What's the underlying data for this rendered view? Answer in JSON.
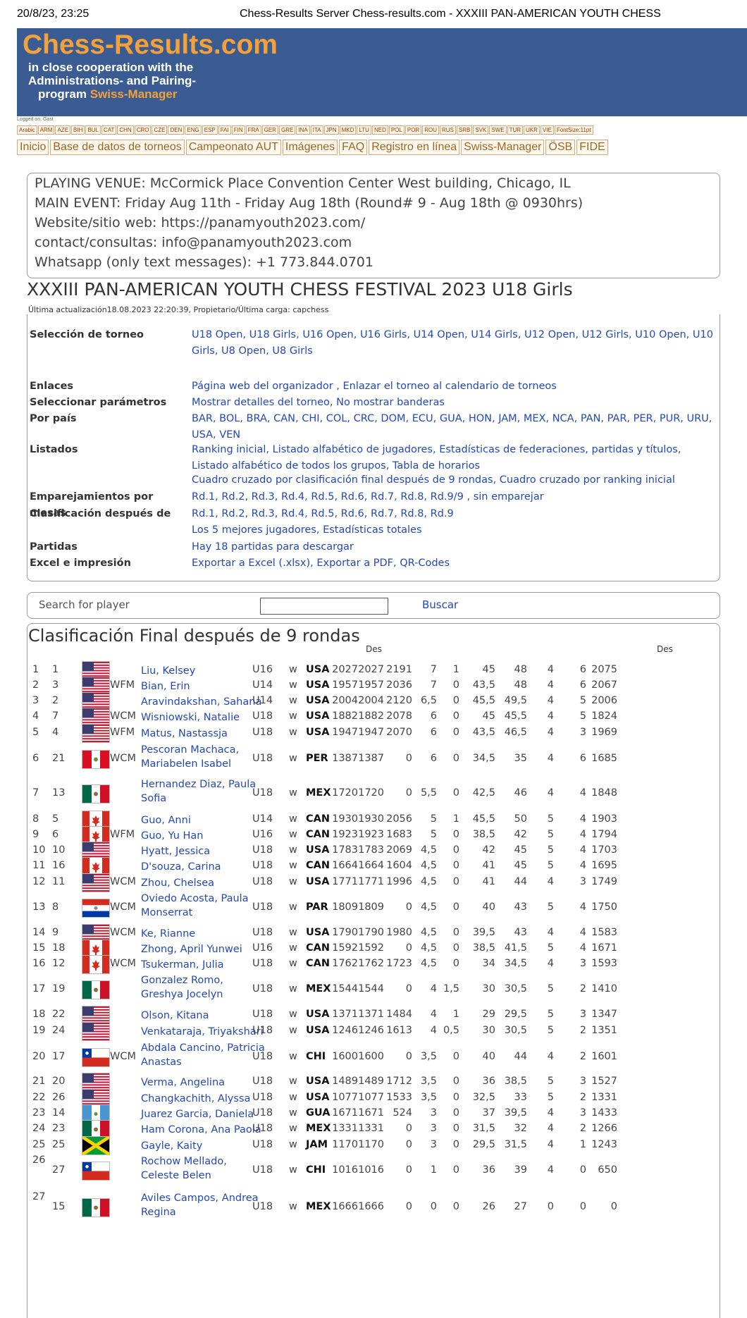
{
  "print_header": {
    "datetime": "20/8/23, 23:25",
    "title": "Chess-Results Server Chess-results.com - XXXIII PAN-AMERICAN YOUTH CHESS"
  },
  "banner": {
    "logo": "Chess-Results.com",
    "line1": "in close cooperation with the",
    "line2": "Administrations- and Pairing-",
    "line3_prefix": "program ",
    "line3_brand": "Swiss-Manager"
  },
  "logged": "Logged on: Gast",
  "languages": [
    "Arabic",
    "ARM",
    "AZE",
    "BIH",
    "BUL",
    "CAT",
    "CHN",
    "CRO",
    "CZE",
    "DEN",
    "ENG",
    "ESP",
    "FAI",
    "FIN",
    "FRA",
    "GER",
    "GRE",
    "INA",
    "ITA",
    "JPN",
    "MKD",
    "LTU",
    "NED",
    "POL",
    "POR",
    "ROU",
    "RUS",
    "SRB",
    "SVK",
    "SWE",
    "TUR",
    "UKR",
    "VIE",
    "FontSize:11pt"
  ],
  "menu": [
    "Inicio",
    "Base de datos de torneos",
    "Campeonato AUT",
    "Imágenes",
    "FAQ",
    "Registro en línea",
    "Swiss-Manager",
    "ÖSB",
    "FIDE"
  ],
  "venue": [
    "PLAYING VENUE: McCormick Place Convention Center West building, Chicago, IL",
    "MAIN EVENT: Friday Aug 11th - Friday Aug 18th (Round# 9 - Aug 18th @ 0930hrs)",
    "Website/sitio web: https://panamyouth2023.com/",
    "contact/consultas: info@panamyouth2023.com",
    "Whatsapp (only text messages): +1 773.844.0701"
  ],
  "event_title": "XXXIII PAN-AMERICAN YOUTH CHESS FESTIVAL 2023 U18 Girls",
  "updated": "Última actualización18.08.2023 22:20:39, Propietario/Última carga: capchess",
  "info": [
    {
      "label": "Selección de torneo",
      "value": "U18 Open, U18 Girls, U16 Open, U16 Girls, U14 Open, U14 Girls, U12 Open, U12 Girls, U10 Open, U10 Girls, U8 Open, U8 Girls"
    },
    {
      "label": "Enlaces",
      "value": " Página web del organizador , Enlazar el torneo al calendario de torneos"
    },
    {
      "label": "Seleccionar parámetros",
      "value": "Mostrar detalles del torneo, No mostrar banderas"
    },
    {
      "label": "Por país",
      "value": "BAR, BOL, BRA, CAN, CHI, COL, CRC, DOM, ECU, GUA, HON, JAM, MEX, NCA, PAN, PAR, PER, PUR, URU, USA, VEN"
    },
    {
      "label": "Listados",
      "value": "Ranking inicial, Listado alfabético de jugadores, Estadísticas de federaciones, partidas y títulos, Listado alfabético de todos los grupos, Tabla de horarios"
    },
    {
      "label": "",
      "value": "Cuadro cruzado por clasificación final después de 9 rondas, Cuadro cruzado por ranking inicial"
    },
    {
      "label": "Emparejamientos por mesas",
      "value": "Rd.1, Rd.2, Rd.3, Rd.4, Rd.5, Rd.6, Rd.7, Rd.8, Rd.9/9 , sin emparejar"
    },
    {
      "label": "Clasificación después de",
      "value": "Rd.1, Rd.2, Rd.3, Rd.4, Rd.5, Rd.6, Rd.7, Rd.8, Rd.9"
    },
    {
      "label": "",
      "value": "Los 5 mejores jugadores, Estadísticas totales"
    },
    {
      "label": "Partidas",
      "value": "Hay 18 partidas para descargar"
    },
    {
      "label": "Excel e impresión",
      "value": "Exportar a Excel (.xlsx), Exportar a PDF, QR-Codes"
    }
  ],
  "search": {
    "label": "Search for player",
    "button": "Buscar"
  },
  "results_title": "Clasificación Final después de 9 rondas",
  "col_headers": {
    "des": "Des",
    "des2": "Des"
  },
  "players": [
    {
      "rk": "1",
      "sno": "1",
      "flag": "usa",
      "title": "",
      "name": "Liu, Kelsey",
      "type": "U16",
      "sex": "w",
      "fed": "USA",
      "r1": "2027",
      "r2": "2027",
      "rp": "2191",
      "pts": "7",
      "t1": "1",
      "t2": "45",
      "t3": "48",
      "t4": "4",
      "t5": "6",
      "t6": "2075"
    },
    {
      "rk": "2",
      "sno": "3",
      "flag": "usa",
      "title": "WFM",
      "name": "Bian, Erin",
      "type": "U14",
      "sex": "w",
      "fed": "USA",
      "r1": "1957",
      "r2": "1957",
      "rp": "2036",
      "pts": "7",
      "t1": "0",
      "t2": "43,5",
      "t3": "48",
      "t4": "4",
      "t5": "6",
      "t6": "2067"
    },
    {
      "rk": "3",
      "sno": "2",
      "flag": "usa",
      "title": "",
      "name": "Aravindakshan, Sahana",
      "type": "U14",
      "sex": "w",
      "fed": "USA",
      "r1": "2004",
      "r2": "2004",
      "rp": "2120",
      "pts": "6,5",
      "t1": "0",
      "t2": "45,5",
      "t3": "49,5",
      "t4": "4",
      "t5": "5",
      "t6": "2006"
    },
    {
      "rk": "4",
      "sno": "7",
      "flag": "usa",
      "title": "WCM",
      "name": "Wisniowski, Natalie",
      "type": "U18",
      "sex": "w",
      "fed": "USA",
      "r1": "1882",
      "r2": "1882",
      "rp": "2078",
      "pts": "6",
      "t1": "0",
      "t2": "45",
      "t3": "45,5",
      "t4": "4",
      "t5": "5",
      "t6": "1824"
    },
    {
      "rk": "5",
      "sno": "4",
      "flag": "usa",
      "title": "WFM",
      "name": "Matus, Nastassja",
      "type": "U18",
      "sex": "w",
      "fed": "USA",
      "r1": "1947",
      "r2": "1947",
      "rp": "2070",
      "pts": "6",
      "t1": "0",
      "t2": "43,5",
      "t3": "46,5",
      "t4": "4",
      "t5": "3",
      "t6": "1969"
    },
    {
      "rk": "6",
      "sno": "21",
      "flag": "per",
      "title": "WCM",
      "name": "Pescoran Machaca, Mariabelen Isabel",
      "type": "U18",
      "sex": "w",
      "fed": "PER",
      "r1": "1387",
      "r2": "1387",
      "rp": "0",
      "pts": "6",
      "t1": "0",
      "t2": "34,5",
      "t3": "35",
      "t4": "4",
      "t5": "6",
      "t6": "1685"
    },
    {
      "rk": "7",
      "sno": "13",
      "flag": "mex",
      "title": "",
      "name": "Hernandez Diaz, Paula Sofia",
      "type": "U18",
      "sex": "w",
      "fed": "MEX",
      "r1": "1720",
      "r2": "1720",
      "rp": "0",
      "pts": "5,5",
      "t1": "0",
      "t2": "42,5",
      "t3": "46",
      "t4": "4",
      "t5": "4",
      "t6": "1848"
    },
    {
      "rk": "8",
      "sno": "5",
      "flag": "can",
      "title": "",
      "name": "Guo, Anni",
      "type": "U14",
      "sex": "w",
      "fed": "CAN",
      "r1": "1930",
      "r2": "1930",
      "rp": "2056",
      "pts": "5",
      "t1": "1",
      "t2": "45,5",
      "t3": "50",
      "t4": "5",
      "t5": "4",
      "t6": "1903"
    },
    {
      "rk": "9",
      "sno": "6",
      "flag": "can",
      "title": "WFM",
      "name": "Guo, Yu Han",
      "type": "U16",
      "sex": "w",
      "fed": "CAN",
      "r1": "1923",
      "r2": "1923",
      "rp": "1683",
      "pts": "5",
      "t1": "0",
      "t2": "38,5",
      "t3": "42",
      "t4": "5",
      "t5": "4",
      "t6": "1794"
    },
    {
      "rk": "10",
      "sno": "10",
      "flag": "usa",
      "title": "",
      "name": "Hyatt, Jessica",
      "type": "U18",
      "sex": "w",
      "fed": "USA",
      "r1": "1783",
      "r2": "1783",
      "rp": "2069",
      "pts": "4,5",
      "t1": "0",
      "t2": "42",
      "t3": "45",
      "t4": "5",
      "t5": "4",
      "t6": "1703"
    },
    {
      "rk": "11",
      "sno": "16",
      "flag": "can",
      "title": "",
      "name": "D'souza, Carina",
      "type": "U18",
      "sex": "w",
      "fed": "CAN",
      "r1": "1664",
      "r2": "1664",
      "rp": "1604",
      "pts": "4,5",
      "t1": "0",
      "t2": "41",
      "t3": "45",
      "t4": "5",
      "t5": "4",
      "t6": "1695"
    },
    {
      "rk": "12",
      "sno": "11",
      "flag": "usa",
      "title": "WCM",
      "name": "Zhou, Chelsea",
      "type": "U18",
      "sex": "w",
      "fed": "USA",
      "r1": "1771",
      "r2": "1771",
      "rp": "1996",
      "pts": "4,5",
      "t1": "0",
      "t2": "41",
      "t3": "44",
      "t4": "4",
      "t5": "3",
      "t6": "1749"
    },
    {
      "rk": "13",
      "sno": "8",
      "flag": "par",
      "title": "WCM",
      "name": "Oviedo Acosta, Paula Monserrat",
      "type": "U18",
      "sex": "w",
      "fed": "PAR",
      "r1": "1809",
      "r2": "1809",
      "rp": "0",
      "pts": "4,5",
      "t1": "0",
      "t2": "40",
      "t3": "43",
      "t4": "5",
      "t5": "4",
      "t6": "1750"
    },
    {
      "rk": "14",
      "sno": "9",
      "flag": "usa",
      "title": "WCM",
      "name": "Ke, Rianne",
      "type": "U18",
      "sex": "w",
      "fed": "USA",
      "r1": "1790",
      "r2": "1790",
      "rp": "1980",
      "pts": "4,5",
      "t1": "0",
      "t2": "39,5",
      "t3": "43",
      "t4": "4",
      "t5": "4",
      "t6": "1583"
    },
    {
      "rk": "15",
      "sno": "18",
      "flag": "can",
      "title": "",
      "name": "Zhong, April Yunwei",
      "type": "U16",
      "sex": "w",
      "fed": "CAN",
      "r1": "1592",
      "r2": "1592",
      "rp": "0",
      "pts": "4,5",
      "t1": "0",
      "t2": "38,5",
      "t3": "41,5",
      "t4": "5",
      "t5": "4",
      "t6": "1671"
    },
    {
      "rk": "16",
      "sno": "12",
      "flag": "can",
      "title": "WCM",
      "name": "Tsukerman, Julia",
      "type": "U18",
      "sex": "w",
      "fed": "CAN",
      "r1": "1762",
      "r2": "1762",
      "rp": "1723",
      "pts": "4,5",
      "t1": "0",
      "t2": "34",
      "t3": "34,5",
      "t4": "4",
      "t5": "3",
      "t6": "1593"
    },
    {
      "rk": "17",
      "sno": "19",
      "flag": "mex",
      "title": "",
      "name": "Gonzalez Romo, Greshya Jocelyn",
      "type": "U18",
      "sex": "w",
      "fed": "MEX",
      "r1": "1544",
      "r2": "1544",
      "rp": "0",
      "pts": "4",
      "t1": "1,5",
      "t2": "30",
      "t3": "30,5",
      "t4": "5",
      "t5": "2",
      "t6": "1410"
    },
    {
      "rk": "18",
      "sno": "22",
      "flag": "usa",
      "title": "",
      "name": "Olson, Kitana",
      "type": "U18",
      "sex": "w",
      "fed": "USA",
      "r1": "1371",
      "r2": "1371",
      "rp": "1484",
      "pts": "4",
      "t1": "1",
      "t2": "29",
      "t3": "29,5",
      "t4": "5",
      "t5": "3",
      "t6": "1347"
    },
    {
      "rk": "19",
      "sno": "24",
      "flag": "usa",
      "title": "",
      "name": "Venkataraja, Triyakshari",
      "type": "U18",
      "sex": "w",
      "fed": "USA",
      "r1": "1246",
      "r2": "1246",
      "rp": "1613",
      "pts": "4",
      "t1": "0,5",
      "t2": "30",
      "t3": "30,5",
      "t4": "5",
      "t5": "2",
      "t6": "1351"
    },
    {
      "rk": "20",
      "sno": "17",
      "flag": "chi",
      "title": "WCM",
      "name": "Abdala Cancino, Patricia Anastas",
      "type": "U18",
      "sex": "w",
      "fed": "CHI",
      "r1": "1600",
      "r2": "1600",
      "rp": "0",
      "pts": "3,5",
      "t1": "0",
      "t2": "40",
      "t3": "44",
      "t4": "4",
      "t5": "2",
      "t6": "1601"
    },
    {
      "rk": "21",
      "sno": "20",
      "flag": "usa",
      "title": "",
      "name": "Verma, Angelina",
      "type": "U18",
      "sex": "w",
      "fed": "USA",
      "r1": "1489",
      "r2": "1489",
      "rp": "1712",
      "pts": "3,5",
      "t1": "0",
      "t2": "36",
      "t3": "38,5",
      "t4": "5",
      "t5": "3",
      "t6": "1527"
    },
    {
      "rk": "22",
      "sno": "26",
      "flag": "usa",
      "title": "",
      "name": "Changkachith, Alyssa",
      "type": "U18",
      "sex": "w",
      "fed": "USA",
      "r1": "1077",
      "r2": "1077",
      "rp": "1533",
      "pts": "3,5",
      "t1": "0",
      "t2": "32,5",
      "t3": "33",
      "t4": "5",
      "t5": "2",
      "t6": "1331"
    },
    {
      "rk": "23",
      "sno": "14",
      "flag": "gua",
      "title": "",
      "name": "Juarez Garcia, Daniela",
      "type": "U18",
      "sex": "w",
      "fed": "GUA",
      "r1": "1671",
      "r2": "1671",
      "rp": "524",
      "pts": "3",
      "t1": "0",
      "t2": "37",
      "t3": "39,5",
      "t4": "4",
      "t5": "3",
      "t6": "1433"
    },
    {
      "rk": "24",
      "sno": "23",
      "flag": "mex",
      "title": "",
      "name": "Ham Corona, Ana Paola",
      "type": "U18",
      "sex": "w",
      "fed": "MEX",
      "r1": "1331",
      "r2": "1331",
      "rp": "0",
      "pts": "3",
      "t1": "0",
      "t2": "31,5",
      "t3": "32",
      "t4": "4",
      "t5": "2",
      "t6": "1266"
    },
    {
      "rk": "25",
      "sno": "25",
      "flag": "jam",
      "title": "",
      "name": "Gayle, Kaity",
      "type": "U18",
      "sex": "w",
      "fed": "JAM",
      "r1": "1170",
      "r2": "1170",
      "rp": "0",
      "pts": "3",
      "t1": "0",
      "t2": "29,5",
      "t3": "31,5",
      "t4": "4",
      "t5": "1",
      "t6": "1243"
    },
    {
      "rk": "26",
      "sno": "27",
      "flag": "chi",
      "title": "",
      "name": "Rochow Mellado, Celeste Belen",
      "type": "U18",
      "sex": "w",
      "fed": "CHI",
      "r1": "1016",
      "r2": "1016",
      "rp": "0",
      "pts": "1",
      "t1": "0",
      "t2": "36",
      "t3": "39",
      "t4": "4",
      "t5": "0",
      "t6": "650"
    },
    {
      "rk": "27",
      "sno": "15",
      "flag": "mex",
      "title": "",
      "name": "Aviles Campos, Andrea Regina",
      "type": "U18",
      "sex": "w",
      "fed": "MEX",
      "r1": "1666",
      "r2": "1666",
      "rp": "0",
      "pts": "0",
      "t1": "0",
      "t2": "26",
      "t3": "27",
      "t4": "0",
      "t5": "0",
      "t6": "0"
    }
  ]
}
